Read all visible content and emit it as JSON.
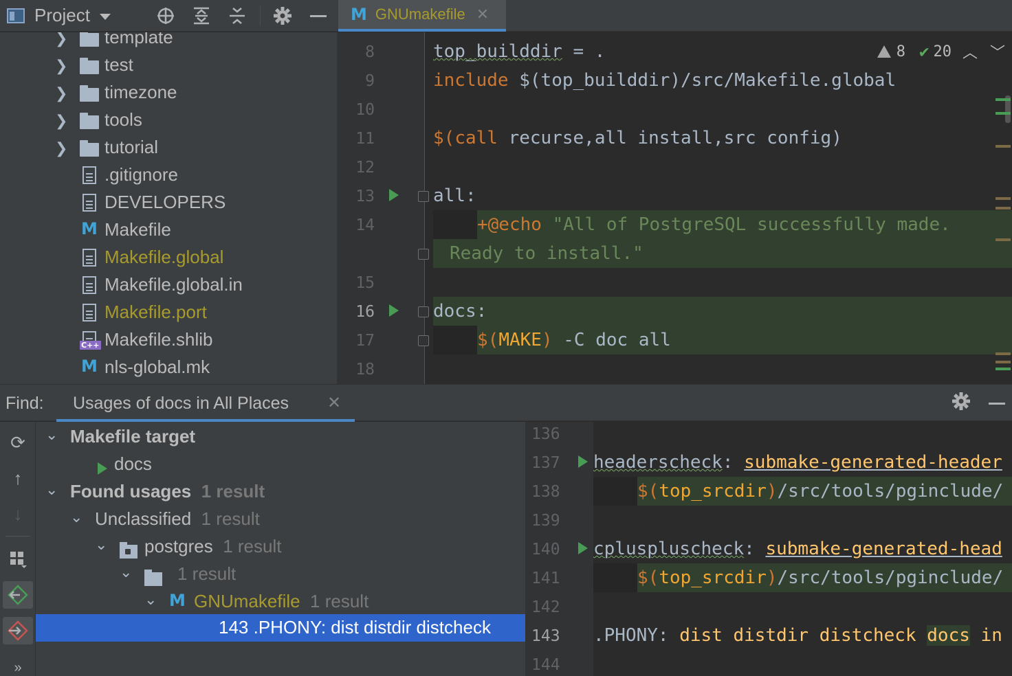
{
  "project_header": {
    "title": "Project"
  },
  "editor_tab": {
    "icon": "M",
    "file_name": "GNUmakefile"
  },
  "project_tree": [
    {
      "label": "template",
      "type": "folder",
      "expandable": true
    },
    {
      "label": "test",
      "type": "folder",
      "expandable": true
    },
    {
      "label": "timezone",
      "type": "folder",
      "expandable": true
    },
    {
      "label": "tools",
      "type": "folder",
      "expandable": true
    },
    {
      "label": "tutorial",
      "type": "folder",
      "expandable": true
    },
    {
      "label": ".gitignore",
      "type": "gitignore-file"
    },
    {
      "label": "DEVELOPERS",
      "type": "text-file"
    },
    {
      "label": "Makefile",
      "type": "makefile"
    },
    {
      "label": "Makefile.global",
      "type": "text-file",
      "modified": true
    },
    {
      "label": "Makefile.global.in",
      "type": "text-file"
    },
    {
      "label": "Makefile.port",
      "type": "text-file",
      "modified": true
    },
    {
      "label": "Makefile.shlib",
      "type": "cpp-file"
    },
    {
      "label": "nls-global.mk",
      "type": "makefile"
    }
  ],
  "editor": {
    "inspections": {
      "warnings": "8",
      "ok": "20"
    },
    "lines": [
      {
        "n": "8"
      },
      {
        "n": "9"
      },
      {
        "n": "10"
      },
      {
        "n": "11"
      },
      {
        "n": "12"
      },
      {
        "n": "13"
      },
      {
        "n": "14"
      },
      {
        "n": "15"
      },
      {
        "n": "16"
      },
      {
        "n": "17"
      },
      {
        "n": "18"
      }
    ],
    "code": {
      "l8_a": "top_builddir",
      "l8_b": " = .",
      "l9_a": "include",
      "l9_b": " $(top_builddir)/src/Makefile.global",
      "l11_a": "$(",
      "l11_b": "call",
      "l11_c": " recurse,all install,src config)",
      "l13": "all:",
      "l14_a": "+@echo",
      "l14_b": " \"All of PostgreSQL successfully made.",
      "l14_wrap": "Ready to install.\"",
      "l16_a": "docs",
      "l16_b": ":",
      "l17_a": "$(",
      "l17_b": "MAKE",
      "l17_c": ")",
      "l17_d": " -C doc all"
    }
  },
  "find": {
    "label": "Find:",
    "tab_title": "Usages of docs in All Places",
    "tree": {
      "target_group": "Makefile target",
      "target_item": "docs",
      "found_usages": "Found usages",
      "found_count": "1 result",
      "unclassified": "Unclassified",
      "unclassified_count": "1 result",
      "postgres": "postgres",
      "postgres_count": "1 result",
      "dir_count": "1 result",
      "file": "GNUmakefile",
      "file_count": "1 result",
      "usage_line": "143 .PHONY: dist distdir distcheck"
    }
  },
  "preview": {
    "line_numbers": [
      "136",
      "137",
      "138",
      "139",
      "140",
      "141",
      "142",
      "143",
      "144"
    ],
    "l137_a": "headerscheck",
    "l137_b": ": ",
    "l137_c": "submake-generated-header",
    "l138_a": "$(",
    "l138_b": "top_srcdir",
    "l138_c": ")",
    "l138_d": "/src/tools/pginclude/",
    "l140_a": "cpluspluscheck",
    "l140_b": ": ",
    "l140_c": "submake-generated-head",
    "l141_a": "$(",
    "l141_b": "top_srcdir",
    "l141_c": ")",
    "l141_d": "/src/tools/pginclude/",
    "l143_a": ".PHONY: ",
    "l143_b": "dist distdir distcheck ",
    "l143_c": "docs",
    "l143_d": " in"
  }
}
